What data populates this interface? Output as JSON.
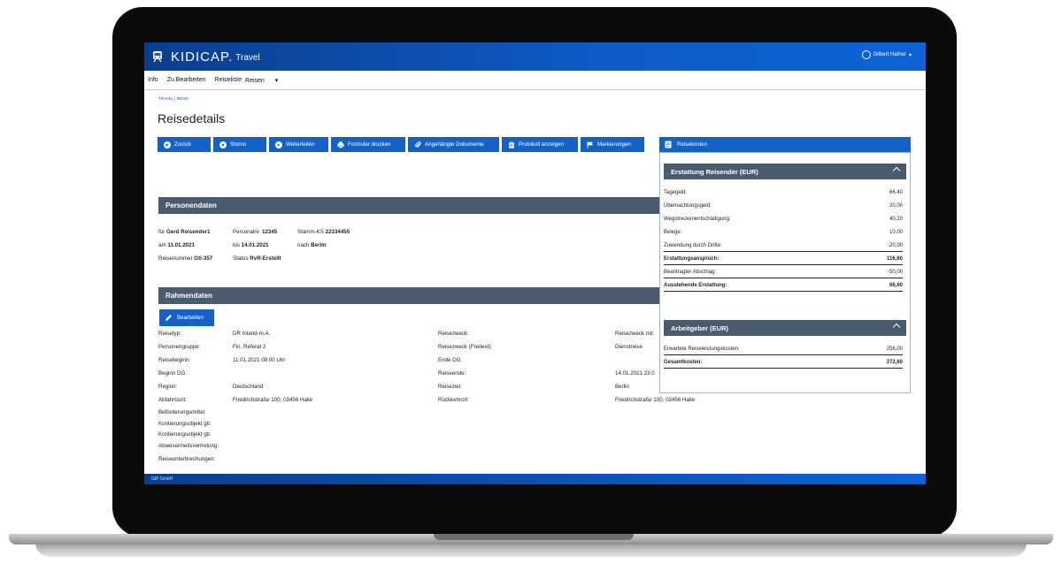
{
  "header": {
    "brand": "KIDICAP.",
    "brand_sub": "Travel",
    "user_name": "Gilbert Hafner"
  },
  "menu": [
    "Info",
    "Zu Bearbeiten",
    "Reiseliste",
    "Reisen"
  ],
  "breadcrumb": "TRAVEL  |  REISE",
  "page_title": "Reisedetails",
  "toolbar": [
    {
      "label": "Zurück",
      "icon": "arrow-left-icon"
    },
    {
      "label": "Storno",
      "icon": "cancel-icon"
    },
    {
      "label": "Weiterleiten",
      "icon": "forward-icon"
    },
    {
      "label": "Formular drucken",
      "icon": "print-icon"
    },
    {
      "label": "Angehängte Dokumente",
      "icon": "paperclip-icon"
    },
    {
      "label": "Protokoll anzeigen",
      "icon": "clipboard-icon"
    },
    {
      "label": "Markierungen",
      "icon": "flag-icon"
    }
  ],
  "personendaten": {
    "title": "Personendaten",
    "row1": {
      "fuer_label": "für",
      "fuer_value": "Gerd Reisender1",
      "persnr_label": "Personalnr.",
      "persnr_value": "12345",
      "stamm_label": "Stamm-KS",
      "stamm_value": "22334455"
    },
    "row2": {
      "am_label": "am",
      "am_value": "11.01.2021",
      "bis_label": "bis",
      "bis_value": "14.01.2021",
      "nach_label": "nach",
      "nach_value": "Berlin"
    },
    "row3": {
      "reisenr_label": "Reisenummer",
      "reisenr_value": "Gti-357",
      "status_label": "Status",
      "status_value": "RvR-Erstellt"
    }
  },
  "rahmendaten": {
    "title": "Rahmendaten",
    "edit_label": "Bearbeiten",
    "left": [
      {
        "label": "Reisetyp:",
        "value": "DR Inland-m.A."
      },
      {
        "label": "Personengruppe:",
        "value": "Fin. Referat 2"
      },
      {
        "label": "Reisebeginn:",
        "value": "11.01.2021  08:00  Uhr"
      },
      {
        "label": "Beginn DG:",
        "value": ""
      },
      {
        "label": "Region:",
        "value": "Deutschland"
      },
      {
        "label": "Abfahrtsort:",
        "value": "Friedrichstraße 100, 03456 Halle"
      }
    ],
    "right": [
      {
        "label": "Reisezweck:",
        "value": "Reisezweck mit"
      },
      {
        "label": "Reisezweck (Freitext):",
        "value": "Dienstreise"
      },
      {
        "label": "Ende DG:",
        "value": ""
      },
      {
        "label": "Reiseende:",
        "value": "14.01.2021  23:0"
      },
      {
        "label": "Reiseziel:",
        "value": "Berlin"
      },
      {
        "label": "Rückkehrort:",
        "value": "Friedrichstraße 100, 03456 Halle"
      }
    ],
    "extra": [
      "Beförderungsmittel:",
      "Kontierungsobjekt gti:",
      "Kontierungsobjekt gti:",
      "Abwesenheitsvertretung:",
      "Reiseunterbrechungen:"
    ]
  },
  "footer": "GIP GmbH",
  "reisekosten": {
    "title": "Reisekosten",
    "erstattung_title": "Erstattung Reisender (EUR)",
    "erstattung_rows": [
      {
        "label": "Tagegeld:",
        "value": "66,40"
      },
      {
        "label": "Übernachtungsgeld:",
        "value": "20,00"
      },
      {
        "label": "Wegstreckenentschädigung:",
        "value": "40,20"
      },
      {
        "label": "Belege:",
        "value": "10,00"
      },
      {
        "label": "Zuwendung durch Dritte:",
        "value": "-20,00"
      },
      {
        "label": "Erstattungsanspruch:",
        "value": "116,60"
      },
      {
        "label": "Beantragter Abschlag:",
        "value": "-50,00"
      },
      {
        "label": "Ausstehende Erstattung:",
        "value": "66,60"
      }
    ],
    "arbeitgeber_title": "Arbeitgeber (EUR)",
    "arbeitgeber_rows": [
      {
        "label": "Erwartete Reiseleistungskosten:",
        "value": "256,00"
      },
      {
        "label": "Gesamtkosten:",
        "value": "372,60"
      }
    ]
  },
  "colors": {
    "primary": "#1462c8",
    "section": "#4a5b70"
  }
}
